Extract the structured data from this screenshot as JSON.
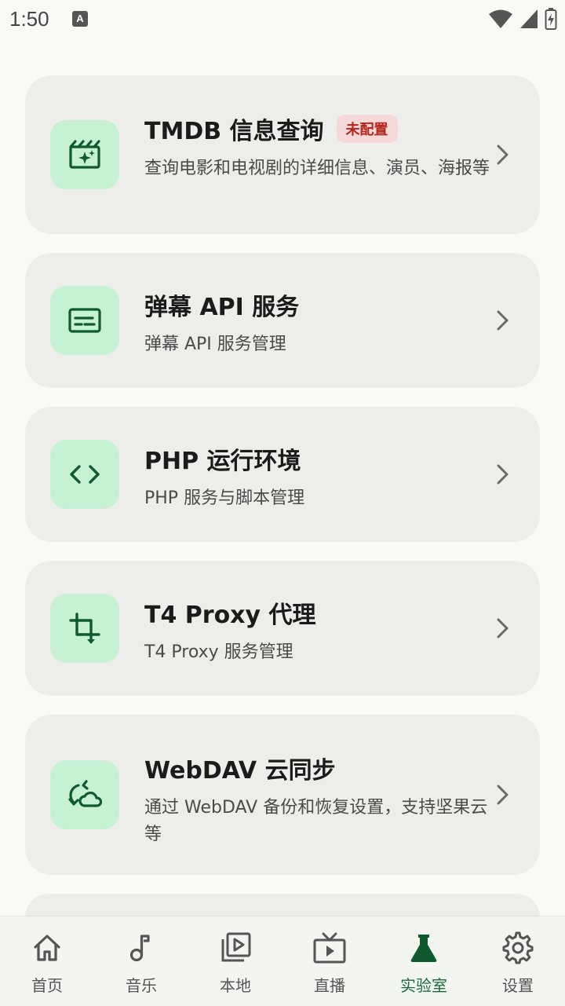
{
  "status_bar": {
    "time": "1:50",
    "badge_letter": "A"
  },
  "cards": [
    {
      "title": "TMDB 信息查询",
      "badge": "未配置",
      "description": "查询电影和电视剧的详细信息、演员、海报等",
      "icon": "movie-sparkle-icon"
    },
    {
      "title": "弹幕 API 服务",
      "description": "弹幕 API 服务管理",
      "icon": "subtitles-icon"
    },
    {
      "title": "PHP 运行环境",
      "description": "PHP 服务与脚本管理",
      "icon": "code-icon"
    },
    {
      "title": "T4 Proxy 代理",
      "description": "T4 Proxy 服务管理",
      "icon": "crop-icon"
    },
    {
      "title": "WebDAV 云同步",
      "description": "通过 WebDAV 备份和恢复设置，支持坚果云等",
      "icon": "cloud-sync-icon"
    }
  ],
  "bottom_nav": [
    {
      "label": "首页",
      "icon": "home-icon"
    },
    {
      "label": "音乐",
      "icon": "music-note-icon"
    },
    {
      "label": "本地",
      "icon": "video-library-icon"
    },
    {
      "label": "直播",
      "icon": "live-tv-icon"
    },
    {
      "label": "实验室",
      "icon": "flask-icon",
      "active": true
    },
    {
      "label": "设置",
      "icon": "gear-icon"
    }
  ],
  "colors": {
    "accent": "#1b6a3a",
    "icon_bg": "#c6f2d3",
    "card_bg": "#ededea",
    "badge_bg": "#f6d9d6",
    "badge_text": "#b3261e"
  }
}
